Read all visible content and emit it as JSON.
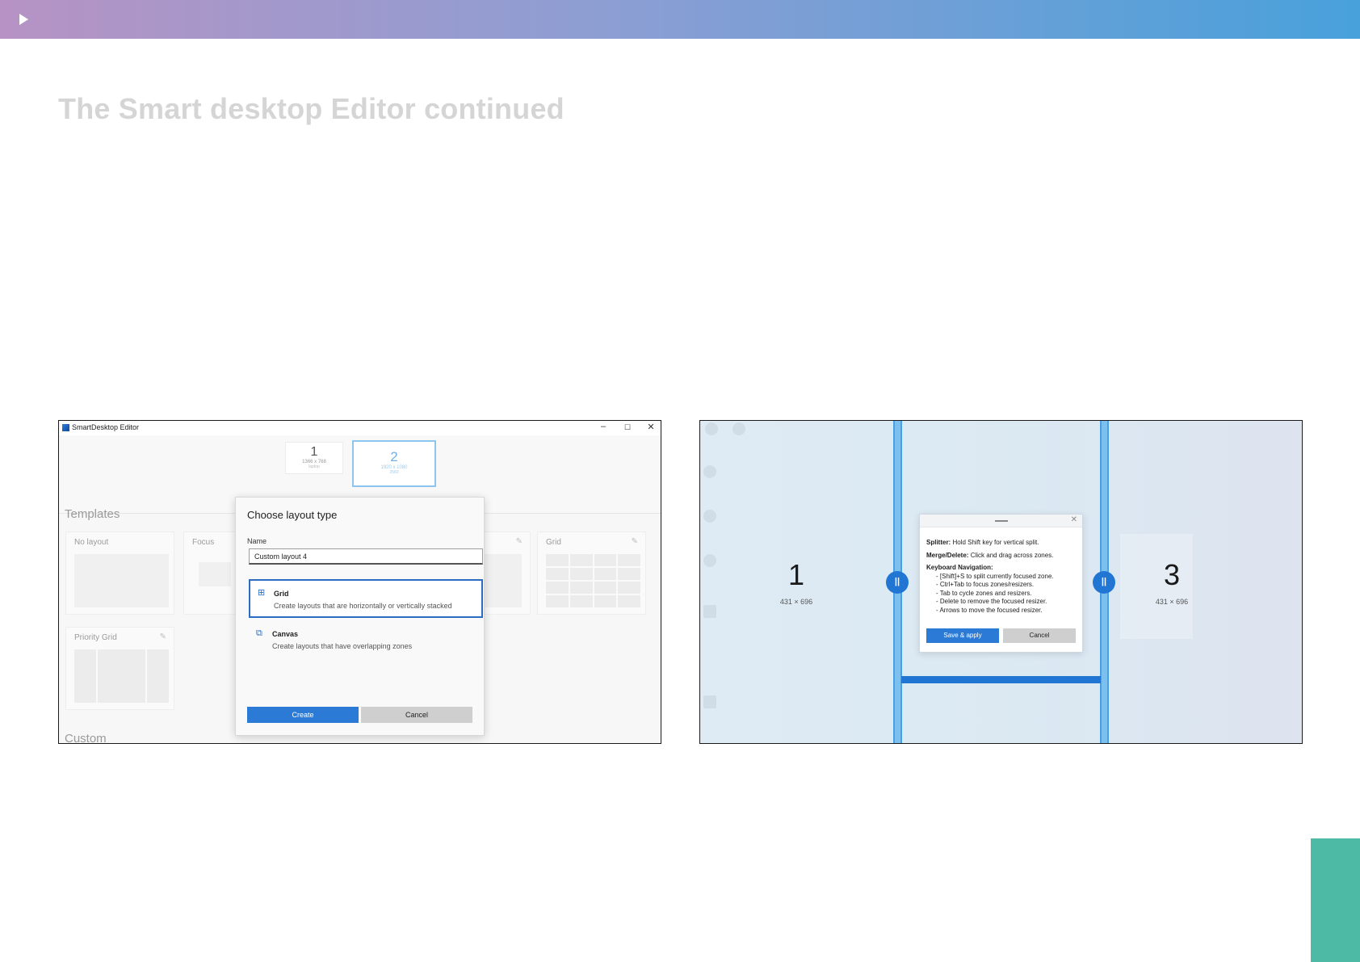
{
  "slide": {
    "title": "The Smart desktop Editor continued"
  },
  "editor": {
    "window_title": "SmartDesktop Editor",
    "controls": {
      "minimize": "–",
      "maximize": "☐",
      "close": "✕"
    },
    "monitors": [
      {
        "number": "1",
        "resolution": "1366 x 768",
        "label": "laptop"
      },
      {
        "number": "2",
        "resolution": "1920 x 1080",
        "label": "2560"
      }
    ],
    "templates_heading": "Templates",
    "custom_heading": "Custom",
    "templates": {
      "no_layout": "No layout",
      "focus": "Focus",
      "grid": "Grid",
      "priority_grid": "Priority Grid"
    },
    "dialog": {
      "title": "Choose layout type",
      "name_label": "Name",
      "name_value": "Custom layout 4",
      "options": [
        {
          "title": "Grid",
          "description": "Create layouts that are horizontally or vertically stacked",
          "icon": "grid-icon",
          "selected": true
        },
        {
          "title": "Canvas",
          "description": "Create layouts that have overlapping zones",
          "icon": "canvas-icon",
          "selected": false
        }
      ],
      "create_label": "Create",
      "cancel_label": "Cancel"
    }
  },
  "zone_editor": {
    "zones": [
      {
        "number": "1",
        "size": "431 × 696"
      },
      {
        "number": "3",
        "size": "431 × 696"
      }
    ],
    "help": {
      "splitter_label": "Splitter:",
      "splitter_text": "Hold Shift key for vertical split.",
      "merge_label": "Merge/Delete:",
      "merge_text": "Click and drag across zones.",
      "nav_label": "Keyboard Navigation:",
      "nav_items": [
        "- [Shift]+S to split currently focused zone.",
        "- Ctrl+Tab to focus zones/resizers.",
        "- Tab to cycle zones and resizers.",
        "- Delete to remove the focused resizer.",
        "- Arrows to move the focused resizer."
      ],
      "save_label": "Save & apply",
      "cancel_label": "Cancel"
    }
  },
  "colors": {
    "band_start": "#b693c4",
    "band_end": "#48a1db",
    "accent_blue": "#2b7bd6",
    "corner_teal": "#4dbaa6"
  }
}
